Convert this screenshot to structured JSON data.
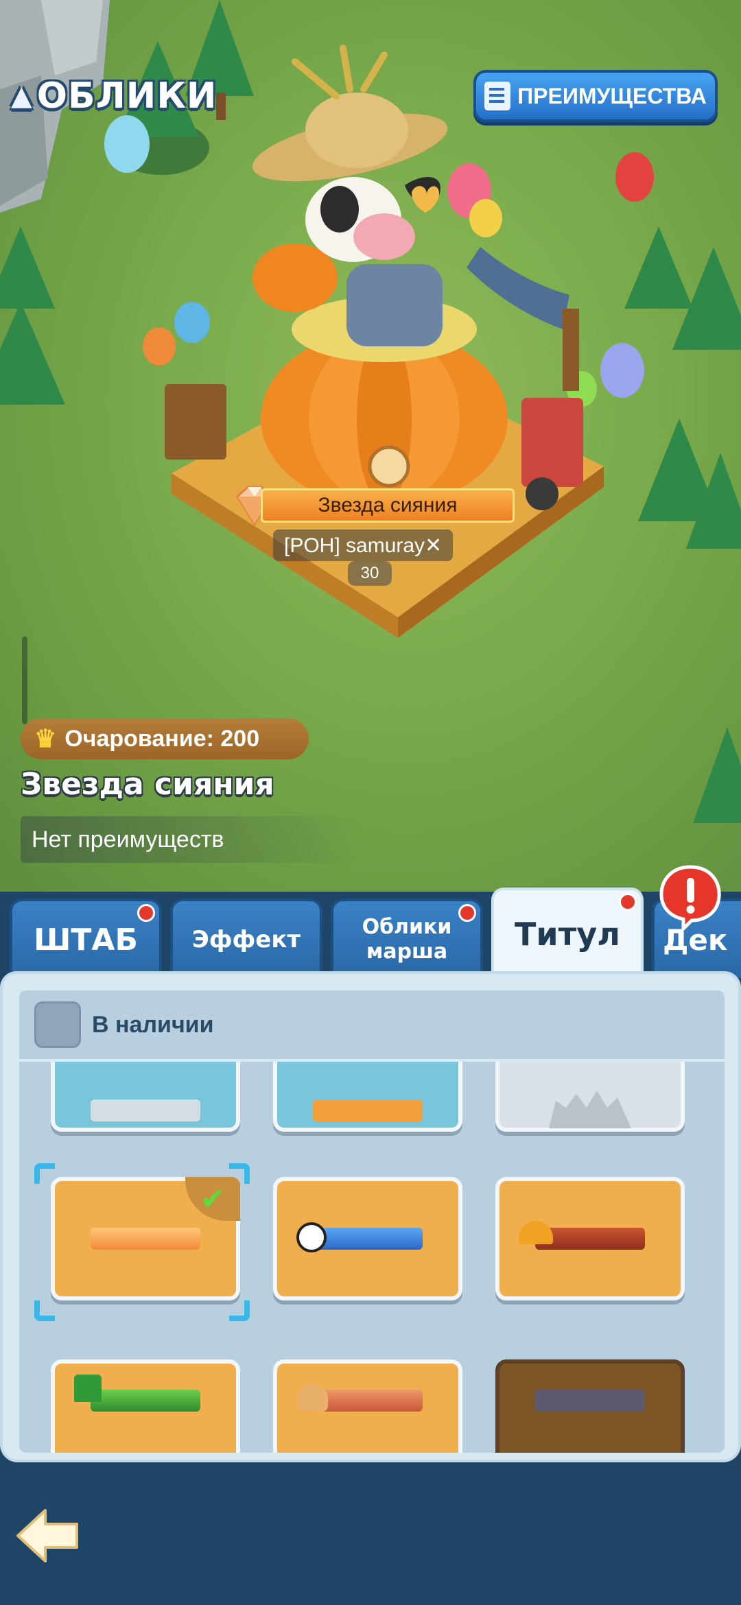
{
  "header": {
    "title": "ОБЛИКИ",
    "title_icon": "tree-icon",
    "advantages_button": "ПРЕИМУЩЕСТВА"
  },
  "preview": {
    "skin_name_plate": "Звезда сияния",
    "player_tag": "[POH] samuray✕",
    "player_level": "30",
    "charm_label": "Очарование: 200",
    "skin_title": "Звезда сияния",
    "perks_text": "Нет преимуществ"
  },
  "tabs": [
    {
      "label": "ШТАБ",
      "has_dot": true,
      "active": false
    },
    {
      "label": "Эффект",
      "has_dot": false,
      "active": false
    },
    {
      "label": "Облики\nмарша",
      "has_dot": true,
      "active": false
    },
    {
      "label": "Титул",
      "has_dot": true,
      "active": true
    },
    {
      "label": "Дек",
      "has_dot": false,
      "active": false
    }
  ],
  "filter": {
    "label": "В наличии",
    "checked": false
  },
  "colors": {
    "accent_blue": "#2a67a6",
    "panel_bg": "#d7e9f3",
    "card_orange": "#f1ae4c",
    "card_blue": "#79c6dc",
    "badge_red": "#e5372b",
    "selected_check": "#5fdb3d"
  },
  "title_cards": [
    {
      "style": "blue",
      "frame": "silver-frame"
    },
    {
      "style": "blue",
      "frame": "orange-frame"
    },
    {
      "style": "gray",
      "frame": "locked-castle-frame"
    },
    {
      "style": "orange",
      "frame": "shining-star-frame",
      "selected": true
    },
    {
      "style": "orange",
      "frame": "football-frame"
    },
    {
      "style": "orange",
      "frame": "hardhat-frame"
    },
    {
      "style": "orange",
      "frame": "leprechaun-hat-frame"
    },
    {
      "style": "orange",
      "frame": "sandwich-frame"
    },
    {
      "style": "locked",
      "frame": "dark-wing-frame"
    }
  ],
  "footer": {
    "back_icon": "back-arrow-icon"
  }
}
